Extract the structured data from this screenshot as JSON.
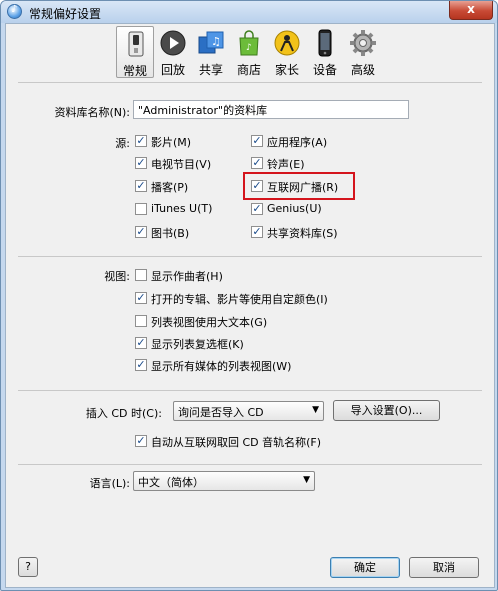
{
  "window": {
    "title": "常规偏好设置",
    "close_glyph": "x"
  },
  "toolbar": {
    "items": [
      {
        "label": "常规",
        "icon": "switch-icon",
        "selected": true
      },
      {
        "label": "回放",
        "icon": "play-icon"
      },
      {
        "label": "共享",
        "icon": "music-note-icon"
      },
      {
        "label": "商店",
        "icon": "shopping-bag-icon"
      },
      {
        "label": "家长",
        "icon": "parental-icon"
      },
      {
        "label": "设备",
        "icon": "iphone-icon"
      },
      {
        "label": "高级",
        "icon": "gear-icon"
      }
    ]
  },
  "library": {
    "label": "资料库名称(N):",
    "value": "\"Administrator\"的资料库"
  },
  "sources": {
    "label": "源:",
    "left": [
      {
        "label": "影片(M)",
        "checked": true
      },
      {
        "label": "电视节目(V)",
        "checked": true
      },
      {
        "label": "播客(P)",
        "checked": true
      },
      {
        "label": "iTunes U(T)",
        "checked": false
      },
      {
        "label": "图书(B)",
        "checked": true
      }
    ],
    "right": [
      {
        "label": "应用程序(A)",
        "checked": true
      },
      {
        "label": "铃声(E)",
        "checked": true
      },
      {
        "label": "互联网广播(R)",
        "checked": true
      },
      {
        "label": "Genius(U)",
        "checked": true
      },
      {
        "label": "共享资料库(S)",
        "checked": true
      }
    ]
  },
  "views": {
    "label": "视图:",
    "items": [
      {
        "label": "显示作曲者(H)",
        "checked": false
      },
      {
        "label": "打开的专辑、影片等使用自定颜色(I)",
        "checked": true
      },
      {
        "label": "列表视图使用大文本(G)",
        "checked": false
      },
      {
        "label": "显示列表复选框(K)",
        "checked": true
      },
      {
        "label": "显示所有媒体的列表视图(W)",
        "checked": true
      }
    ]
  },
  "cd": {
    "label": "插入 CD 时(C):",
    "selected": "询问是否导入 CD",
    "import_button": "导入设置(O)...",
    "auto_fetch": {
      "label": "自动从互联网取回 CD 音轨名称(F)",
      "checked": true
    }
  },
  "language": {
    "label": "语言(L):",
    "selected": "中文（简体）"
  },
  "buttons": {
    "help": "?",
    "ok": "确定",
    "cancel": "取消"
  },
  "colors": {
    "accent": "#d4141c",
    "title_bar": "#c5d8ee"
  }
}
